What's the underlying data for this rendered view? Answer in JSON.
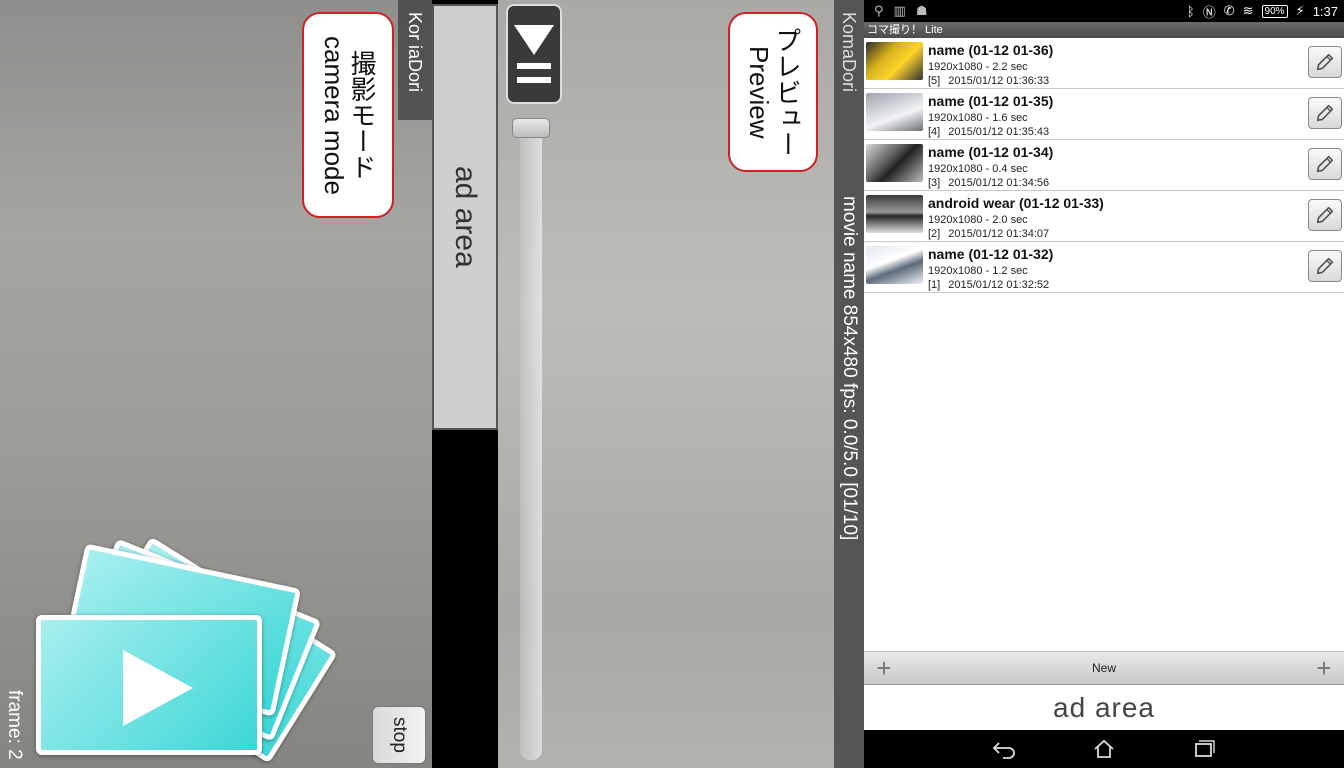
{
  "camera": {
    "app_name": "Kor iaDori",
    "callout_line1": "撮影モード",
    "callout_line2": "camera mode",
    "stop_label": "stop",
    "frame_counter": "frame: 2"
  },
  "ad_vertical": "ad area",
  "preview": {
    "callout_line1": "プレビュー",
    "callout_line2": "Preview",
    "app_name": "KomaDori",
    "movie_info": "movie name   854x480   fps: 0.0/5.0   [01/10]"
  },
  "phone": {
    "status": {
      "battery": "90%",
      "time": "1:37"
    },
    "app_title": "コマ撮り！ Lite",
    "movies": [
      {
        "title": "name (01-12 01-36)",
        "meta": "1920x1080 - 2.2 sec",
        "index": "[5]",
        "date": "2015/01/12 01:36:33"
      },
      {
        "title": "name (01-12 01-35)",
        "meta": "1920x1080 - 1.6 sec",
        "index": "[4]",
        "date": "2015/01/12 01:35:43"
      },
      {
        "title": "name (01-12 01-34)",
        "meta": "1920x1080 - 0.4 sec",
        "index": "[3]",
        "date": "2015/01/12 01:34:56"
      },
      {
        "title": "android wear (01-12 01-33)",
        "meta": "1920x1080 - 2.0 sec",
        "index": "[2]",
        "date": "2015/01/12 01:34:07"
      },
      {
        "title": "name (01-12 01-32)",
        "meta": "1920x1080 - 1.2 sec",
        "index": "[1]",
        "date": "2015/01/12 01:32:52"
      }
    ],
    "new_label": "New",
    "ad_label": "ad area",
    "icons": {
      "edit": "pencil-icon",
      "add": "plus-icon",
      "nav": [
        "back-icon",
        "home-icon",
        "recent-apps-icon"
      ]
    }
  }
}
